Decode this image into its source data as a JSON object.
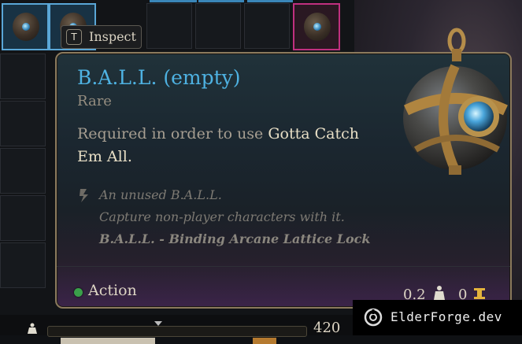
{
  "inspect": {
    "key": "T",
    "label": "Inspect"
  },
  "item": {
    "name": "B.A.L.L. (empty)",
    "rarity": "Rare",
    "requirement_prefix": "Required in order to use ",
    "requirement_highlight": "Gotta Catch Em All",
    "requirement_suffix": ".",
    "lore_line1": "An unused B.A.L.L.",
    "lore_line2": "Capture non-player characters with it.",
    "lore_line3": "B.A.L.L. - Binding Arcane Lattice Lock",
    "action_label": "Action",
    "weight": "0.2",
    "price": "0"
  },
  "carry_weight": {
    "value": "420"
  },
  "watermark": {
    "text": "ElderForge.dev"
  },
  "colors": {
    "title": "#4eb2e2",
    "rarity": "#958d80",
    "action_dot": "#3aa04a",
    "slot_selected_border": "#5aa6d6",
    "slot_pink_border": "#c0307f"
  }
}
